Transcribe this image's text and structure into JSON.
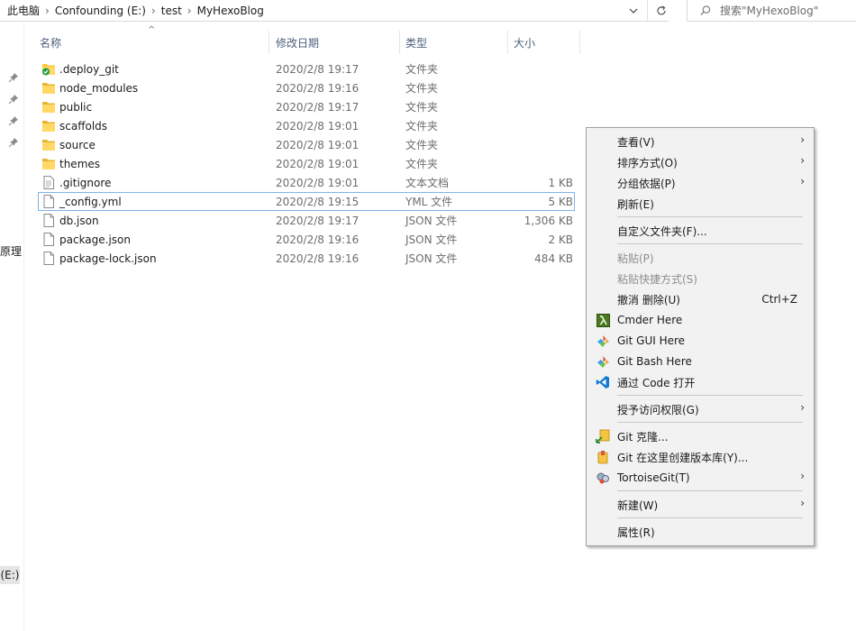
{
  "address": {
    "crumbs": [
      "此电脑",
      "Confounding (E:)",
      "test",
      "MyHexoBlog"
    ],
    "search_placeholder": "搜索\"MyHexoBlog\""
  },
  "nav": {
    "partial_text": "原理",
    "drive_label": "(E:)"
  },
  "columns": {
    "name": "名称",
    "date": "修改日期",
    "type": "类型",
    "size": "大小"
  },
  "files": [
    {
      "name": ".deploy_git",
      "date": "2020/2/8 19:17",
      "type": "文件夹",
      "size": "",
      "icon": "folder-synced-icon"
    },
    {
      "name": "node_modules",
      "date": "2020/2/8 19:16",
      "type": "文件夹",
      "size": "",
      "icon": "folder-icon"
    },
    {
      "name": "public",
      "date": "2020/2/8 19:17",
      "type": "文件夹",
      "size": "",
      "icon": "folder-icon"
    },
    {
      "name": "scaffolds",
      "date": "2020/2/8 19:01",
      "type": "文件夹",
      "size": "",
      "icon": "folder-icon"
    },
    {
      "name": "source",
      "date": "2020/2/8 19:01",
      "type": "文件夹",
      "size": "",
      "icon": "folder-icon"
    },
    {
      "name": "themes",
      "date": "2020/2/8 19:01",
      "type": "文件夹",
      "size": "",
      "icon": "folder-icon"
    },
    {
      "name": ".gitignore",
      "date": "2020/2/8 19:01",
      "type": "文本文档",
      "size": "1 KB",
      "icon": "text-file-icon"
    },
    {
      "name": "_config.yml",
      "date": "2020/2/8 19:15",
      "type": "YML 文件",
      "size": "5 KB",
      "icon": "file-icon"
    },
    {
      "name": "db.json",
      "date": "2020/2/8 19:17",
      "type": "JSON 文件",
      "size": "1,306 KB",
      "icon": "file-icon"
    },
    {
      "name": "package.json",
      "date": "2020/2/8 19:16",
      "type": "JSON 文件",
      "size": "2 KB",
      "icon": "file-icon"
    },
    {
      "name": "package-lock.json",
      "date": "2020/2/8 19:16",
      "type": "JSON 文件",
      "size": "484 KB",
      "icon": "file-icon"
    }
  ],
  "context_menu": {
    "view": "查看(V)",
    "sort": "排序方式(O)",
    "group": "分组依据(P)",
    "refresh": "刷新(E)",
    "customize": "自定义文件夹(F)...",
    "paste": "粘贴(P)",
    "paste_shortcut": "粘贴快捷方式(S)",
    "undo_delete": "撤消 删除(U)",
    "undo_shortcut": "Ctrl+Z",
    "cmder": "Cmder Here",
    "git_gui": "Git GUI Here",
    "git_bash": "Git Bash Here",
    "vscode": "通过 Code 打开",
    "give_access": "授予访问权限(G)",
    "git_clone": "Git 克隆...",
    "git_create_repo": "Git 在这里创建版本库(Y)...",
    "tortoisegit": "TortoiseGit(T)",
    "new": "新建(W)",
    "properties": "属性(R)"
  },
  "colors": {
    "folder": "#ffc83d",
    "header_text": "#4c607a",
    "focus_border": "#7eb4ea",
    "menu_bg": "#f2f2f2"
  }
}
